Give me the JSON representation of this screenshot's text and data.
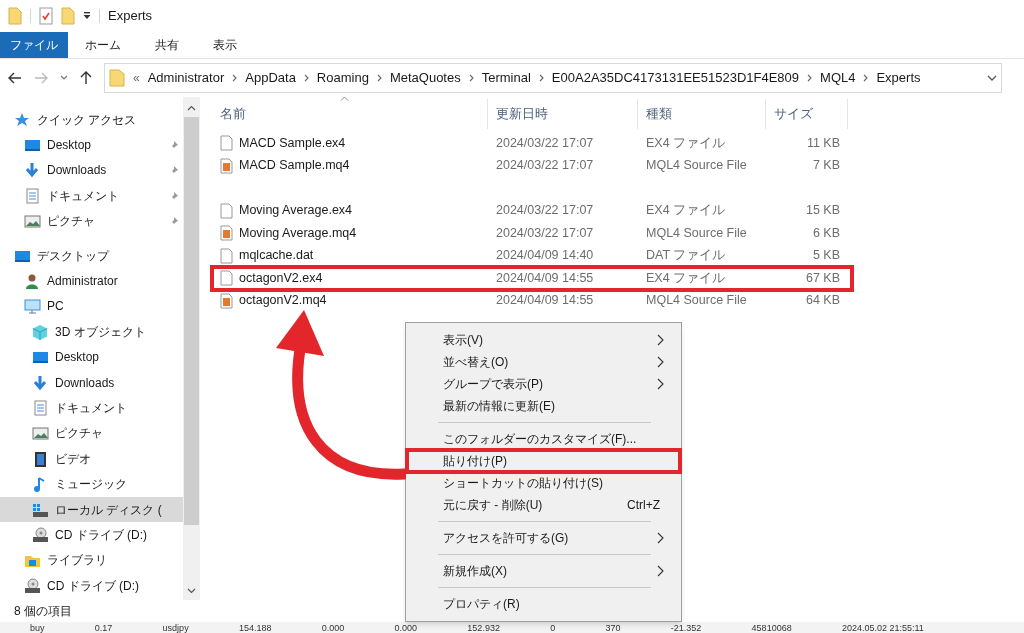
{
  "window": {
    "title": "Experts"
  },
  "ribbon_tabs": [
    {
      "label": "ファイル",
      "selected": true
    },
    {
      "label": "ホーム",
      "selected": false
    },
    {
      "label": "共有",
      "selected": false
    },
    {
      "label": "表示",
      "selected": false
    }
  ],
  "address_bar": {
    "overflow": "«",
    "segments": [
      "Administrator",
      "AppData",
      "Roaming",
      "MetaQuotes",
      "Terminal",
      "E00A2A35DC4173131EE51523D1F4E809",
      "MQL4",
      "Experts"
    ]
  },
  "nav_pane": {
    "items": [
      {
        "label": "クイック アクセス",
        "kind": "star",
        "selected": false,
        "pinned": false,
        "children": [
          {
            "label": "Desktop",
            "kind": "desktop",
            "selected": false,
            "pinned": true
          },
          {
            "label": "Downloads",
            "kind": "download",
            "selected": false,
            "pinned": true
          },
          {
            "label": "ドキュメント",
            "kind": "document",
            "selected": false,
            "pinned": true
          },
          {
            "label": "ピクチャ",
            "kind": "picture",
            "selected": false,
            "pinned": true
          }
        ]
      },
      {
        "label": "デスクトップ",
        "kind": "desktop",
        "selected": false,
        "pinned": false,
        "children": [
          {
            "label": "Administrator",
            "kind": "user",
            "selected": false,
            "pinned": false
          },
          {
            "label": "PC",
            "kind": "pc",
            "selected": false,
            "pinned": false,
            "children": [
              {
                "label": "3D オブジェクト",
                "kind": "cube",
                "selected": false,
                "pinned": false
              },
              {
                "label": "Desktop",
                "kind": "desktop",
                "selected": false,
                "pinned": false
              },
              {
                "label": "Downloads",
                "kind": "download",
                "selected": false,
                "pinned": false
              },
              {
                "label": "ドキュメント",
                "kind": "document",
                "selected": false,
                "pinned": false
              },
              {
                "label": "ピクチャ",
                "kind": "picture",
                "selected": false,
                "pinned": false
              },
              {
                "label": "ビデオ",
                "kind": "video",
                "selected": false,
                "pinned": false
              },
              {
                "label": "ミュージック",
                "kind": "music",
                "selected": false,
                "pinned": false
              },
              {
                "label": "ローカル ディスク (",
                "kind": "drive",
                "selected": true,
                "pinned": false
              },
              {
                "label": "CD ドライブ (D:)",
                "kind": "cd",
                "selected": false,
                "pinned": false
              }
            ]
          },
          {
            "label": "ライブラリ",
            "kind": "library",
            "selected": false,
            "pinned": false
          },
          {
            "label": "CD ドライブ (D:)",
            "kind": "cd",
            "selected": false,
            "pinned": false
          }
        ]
      }
    ]
  },
  "file_list": {
    "columns": [
      {
        "label": "名前",
        "sorted": true
      },
      {
        "label": "更新日時",
        "sorted": false
      },
      {
        "label": "種類",
        "sorted": false
      },
      {
        "label": "サイズ",
        "sorted": false
      }
    ],
    "rows": [
      {
        "name": "MACD Sample.ex4",
        "modified": "2024/03/22 17:07",
        "type": "EX4 ファイル",
        "size": "11 KB",
        "kind": "plain",
        "gap_before": false,
        "highlighted": false
      },
      {
        "name": "MACD Sample.mq4",
        "modified": "2024/03/22 17:07",
        "type": "MQL4 Source File",
        "size": "7 KB",
        "kind": "source",
        "gap_before": false,
        "highlighted": false
      },
      {
        "name": "Moving Average.ex4",
        "modified": "2024/03/22 17:07",
        "type": "EX4 ファイル",
        "size": "15 KB",
        "kind": "plain",
        "gap_before": true,
        "highlighted": false
      },
      {
        "name": "Moving Average.mq4",
        "modified": "2024/03/22 17:07",
        "type": "MQL4 Source File",
        "size": "6 KB",
        "kind": "source",
        "gap_before": false,
        "highlighted": false
      },
      {
        "name": "mqlcache.dat",
        "modified": "2024/04/09 14:40",
        "type": "DAT ファイル",
        "size": "5 KB",
        "kind": "plain",
        "gap_before": false,
        "highlighted": false
      },
      {
        "name": "octagonV2.ex4",
        "modified": "2024/04/09 14:55",
        "type": "EX4 ファイル",
        "size": "67 KB",
        "kind": "plain",
        "gap_before": false,
        "highlighted": true
      },
      {
        "name": "octagonV2.mq4",
        "modified": "2024/04/09 14:55",
        "type": "MQL4 Source File",
        "size": "64 KB",
        "kind": "source",
        "gap_before": false,
        "highlighted": false
      }
    ]
  },
  "context_menu": {
    "items": [
      {
        "kind": "item",
        "label": "表示(V)",
        "submenu": true,
        "highlighted": false
      },
      {
        "kind": "item",
        "label": "並べ替え(O)",
        "submenu": true,
        "highlighted": false
      },
      {
        "kind": "item",
        "label": "グループで表示(P)",
        "submenu": true,
        "highlighted": false
      },
      {
        "kind": "item",
        "label": "最新の情報に更新(E)",
        "submenu": false,
        "highlighted": false
      },
      {
        "kind": "separator"
      },
      {
        "kind": "item",
        "label": "このフォルダーのカスタマイズ(F)...",
        "submenu": false,
        "highlighted": false
      },
      {
        "kind": "item",
        "label": "貼り付け(P)",
        "submenu": false,
        "highlighted": true
      },
      {
        "kind": "item",
        "label": "ショートカットの貼り付け(S)",
        "submenu": false,
        "highlighted": false
      },
      {
        "kind": "item",
        "label": "元に戻す - 削除(U)",
        "shortcut": "Ctrl+Z",
        "submenu": false,
        "highlighted": false
      },
      {
        "kind": "separator"
      },
      {
        "kind": "item",
        "label": "アクセスを許可する(G)",
        "submenu": true,
        "highlighted": false
      },
      {
        "kind": "separator"
      },
      {
        "kind": "item",
        "label": "新規作成(X)",
        "submenu": true,
        "highlighted": false
      },
      {
        "kind": "separator"
      },
      {
        "kind": "item",
        "label": "プロパティ(R)",
        "submenu": false,
        "highlighted": false
      }
    ]
  },
  "status_bar": {
    "item_count": "8 個の項目"
  },
  "background_window_row": [
    "buy",
    "0.17",
    "usdjpy",
    "154.188",
    "0.000",
    "0.000",
    "152.932",
    "0",
    "370",
    "-21.352",
    "45810068",
    "2024.05.02 21:55:11"
  ]
}
